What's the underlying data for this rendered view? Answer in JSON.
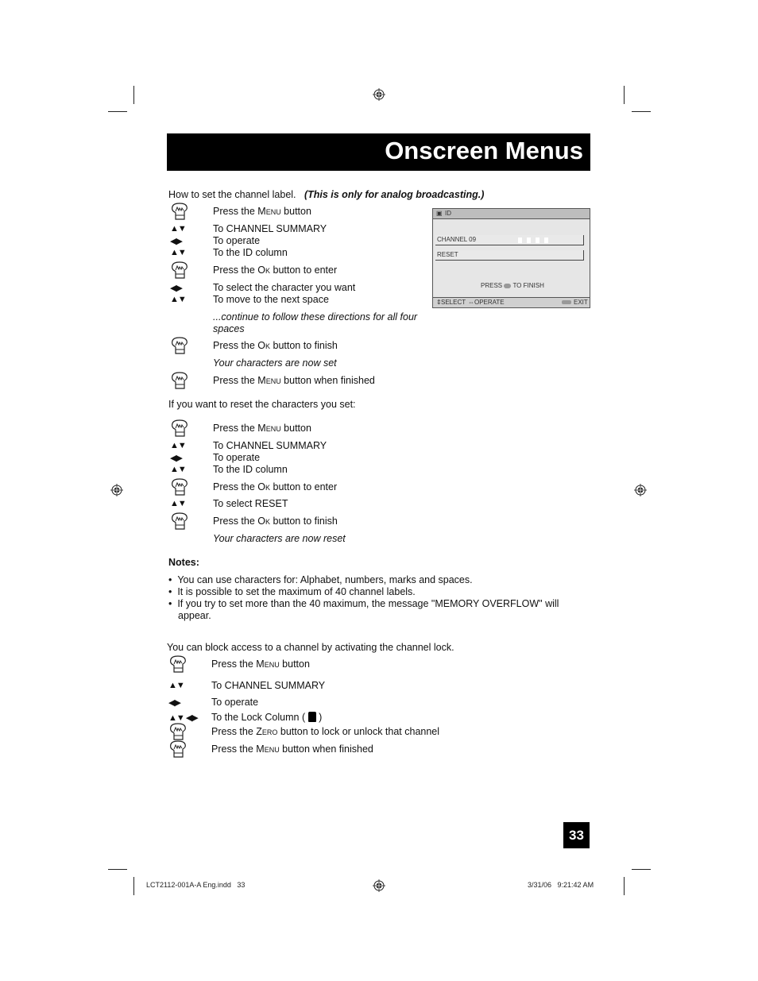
{
  "header": {
    "title": "Onscreen Menus"
  },
  "section1": {
    "intro": "How to set the channel label.",
    "intro_note": "(This is only for analog broadcasting.)",
    "steps": [
      {
        "icon": "hand-icon",
        "pre": "Press the ",
        "key": "Menu",
        "post": " button"
      },
      {
        "icon": "up-down-arrows-icon",
        "text": "To CHANNEL SUMMARY"
      },
      {
        "icon": "left-right-arrows-icon",
        "text": "To operate"
      },
      {
        "icon": "up-down-arrows-icon",
        "text": "To the ID column"
      },
      {
        "icon": "hand-icon",
        "pre": "Press the ",
        "key": "Ok",
        "post": " button to enter"
      },
      {
        "icon": "left-right-arrows-icon",
        "text": "To select the character you want"
      },
      {
        "icon": "up-down-arrows-icon",
        "text": "To move to the next space"
      },
      {
        "italic": "...continue to follow these directions for all four spaces"
      },
      {
        "icon": "hand-icon",
        "pre": "Press the ",
        "key": "Ok",
        "post": " button to finish"
      },
      {
        "italic": "Your characters are now set"
      },
      {
        "icon": "hand-icon",
        "pre": "Press the ",
        "key": "Menu",
        "post": " button when finished"
      }
    ]
  },
  "section2": {
    "intro": "If you want to reset the characters you set:",
    "steps": [
      {
        "icon": "hand-icon",
        "pre": "Press the ",
        "key": "Menu",
        "post": " button"
      },
      {
        "icon": "up-down-arrows-icon",
        "text": "To CHANNEL SUMMARY"
      },
      {
        "icon": "left-right-arrows-icon",
        "text": "To operate"
      },
      {
        "icon": "up-down-arrows-icon",
        "text": "To the ID column"
      },
      {
        "icon": "hand-icon",
        "pre": "Press the ",
        "key": "Ok",
        "post": " button to enter"
      },
      {
        "icon": "up-down-arrows-icon",
        "text": "To select RESET"
      },
      {
        "icon": "hand-icon",
        "pre": "Press the ",
        "key": "Ok",
        "post": " button to finish"
      },
      {
        "italic": "Your characters are now reset"
      }
    ]
  },
  "notes": {
    "heading": "Notes:",
    "items": [
      "You can use characters for: Alphabet, numbers, marks and spaces.",
      "It is possible to set the maximum of 40 channel labels.",
      "If you try to set more than the 40 maximum, the message \"MEMORY OVERFLOW\" will",
      "appear."
    ]
  },
  "section3": {
    "intro": "You can block access to a channel by activating the channel lock.",
    "steps": [
      {
        "icon": "hand-icon",
        "pre": "Press the ",
        "key": "Menu",
        "post": " button"
      },
      {
        "icon": "up-down-arrows-icon",
        "text": "To CHANNEL SUMMARY"
      },
      {
        "icon": "left-right-arrows-icon",
        "text": "To operate"
      },
      {
        "icon": "all-arrows-icon",
        "text": "To the Lock Column (",
        "text_after": ")"
      },
      {
        "icon": "hand-icon",
        "pre": "Press the ",
        "key": "Zero",
        "post": " button to lock or unlock that channel"
      },
      {
        "icon": "hand-icon",
        "pre": "Press the ",
        "key": "Menu",
        "post": " button when finished"
      }
    ]
  },
  "screen": {
    "header": "ID",
    "row1": "CHANNEL 09",
    "row2": "RESET",
    "press": "PRESS",
    "to_finish": "TO FINISH",
    "select": "SELECT",
    "operate": "OPERATE",
    "exit": "EXIT",
    "slot_count": 4
  },
  "footer": {
    "page_number": "33",
    "file": "LCT2112-001A-A Eng.indd   33",
    "datetime": "3/31/06   9:21:42 AM"
  }
}
